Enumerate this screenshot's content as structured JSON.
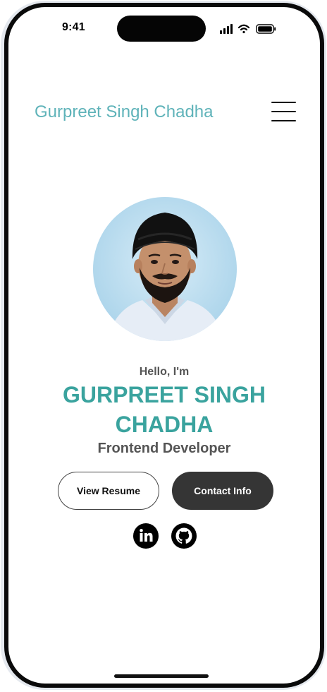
{
  "status_bar": {
    "time": "9:41"
  },
  "header": {
    "brand": "Gurpreet Singh Chadha",
    "menu_icon": "hamburger-menu-icon"
  },
  "hero": {
    "greeting": "Hello, I'm",
    "name_line1": "GURPREET SINGH",
    "name_line2": "CHADHA",
    "role": "Frontend Developer"
  },
  "buttons": {
    "resume": "View Resume",
    "contact": "Contact Info"
  },
  "social": {
    "linkedin_icon": "linkedin-icon",
    "github_icon": "github-icon"
  },
  "colors": {
    "brand": "#5fb3b9",
    "accent": "#3aa39e",
    "dark_button": "#353535",
    "muted_text": "#555555"
  }
}
